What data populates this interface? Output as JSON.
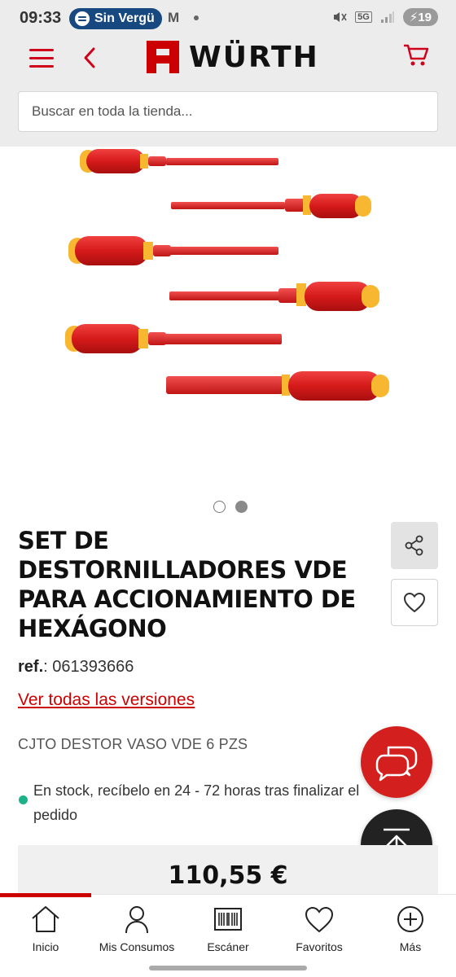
{
  "status_bar": {
    "time": "09:33",
    "spotify_label": "Sin Vergü",
    "gmail_glyph": "M",
    "network": "5G",
    "battery": "19"
  },
  "header": {
    "brand": "WÜRTH",
    "brand_color": "#cc0000",
    "search_placeholder": "Buscar en toda la tienda...",
    "icons": [
      "menu-icon",
      "back-chevron-icon",
      "wurth-logo",
      "cart-icon"
    ]
  },
  "gallery": {
    "image_alt": "product-image",
    "slides": 2,
    "active_slide": 2
  },
  "product": {
    "title": "SET DE DESTORNILLADORES VDE PARA ACCIONAMIENTO DE HEXÁGONO",
    "ref_label": "ref.",
    "ref_value": ": 061393666",
    "versions_link": "Ver todas las versiones",
    "short_description": "CJTO DESTOR VASO VDE 6 PZS",
    "stock_text": "En stock, recíbelo en 24 - 72 horas tras finalizar el pedido",
    "stock_color": "#1cb38a",
    "price": "110,55 €"
  },
  "bottom_nav": {
    "items": [
      {
        "label": "Inicio",
        "icon": "home-icon"
      },
      {
        "label": "Mis Consumos",
        "icon": "user-icon"
      },
      {
        "label": "Escáner",
        "icon": "barcode-icon"
      },
      {
        "label": "Favoritos",
        "icon": "heart-icon"
      },
      {
        "label": "Más",
        "icon": "plus-circle-icon"
      }
    ],
    "active": 0
  }
}
